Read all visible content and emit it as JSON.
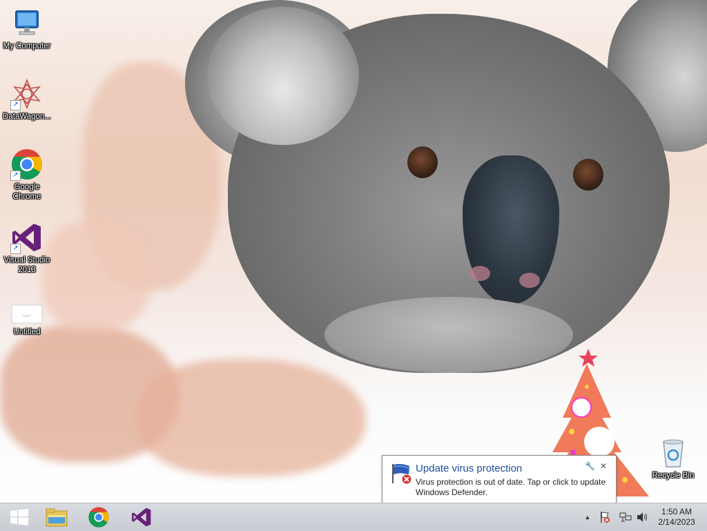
{
  "desktop": {
    "icons": [
      {
        "label": "My Computer",
        "icon": "computer-icon"
      },
      {
        "label": "DataWagon...",
        "icon": "datawagon-icon"
      },
      {
        "label": "Google Chrome",
        "icon": "chrome-icon"
      },
      {
        "label": "Visual Studio 2013",
        "icon": "visual-studio-icon"
      },
      {
        "label": "Untitled",
        "icon": "document-icon"
      },
      {
        "label": "Recycle Bin",
        "icon": "recycle-bin-icon"
      }
    ]
  },
  "notification": {
    "title": "Update virus protection",
    "body": "Virus protection is out of date. Tap or click to update Windows Defender.",
    "icon": "defender-flag-icon"
  },
  "taskbar": {
    "pinned": [
      {
        "name": "start-button",
        "icon": "windows-logo-icon"
      },
      {
        "name": "file-explorer",
        "icon": "folder-icon"
      },
      {
        "name": "google-chrome",
        "icon": "chrome-icon"
      },
      {
        "name": "visual-studio",
        "icon": "visual-studio-icon"
      }
    ],
    "tray": {
      "expand_glyph": "▲",
      "time": "1:50 AM",
      "date": "2/14/2023"
    }
  },
  "colors": {
    "balloon_title": "#1e4d9a",
    "taskbar": "#d8dbe0",
    "vs_purple": "#68217a",
    "tree_orange": "#f07a5a"
  }
}
